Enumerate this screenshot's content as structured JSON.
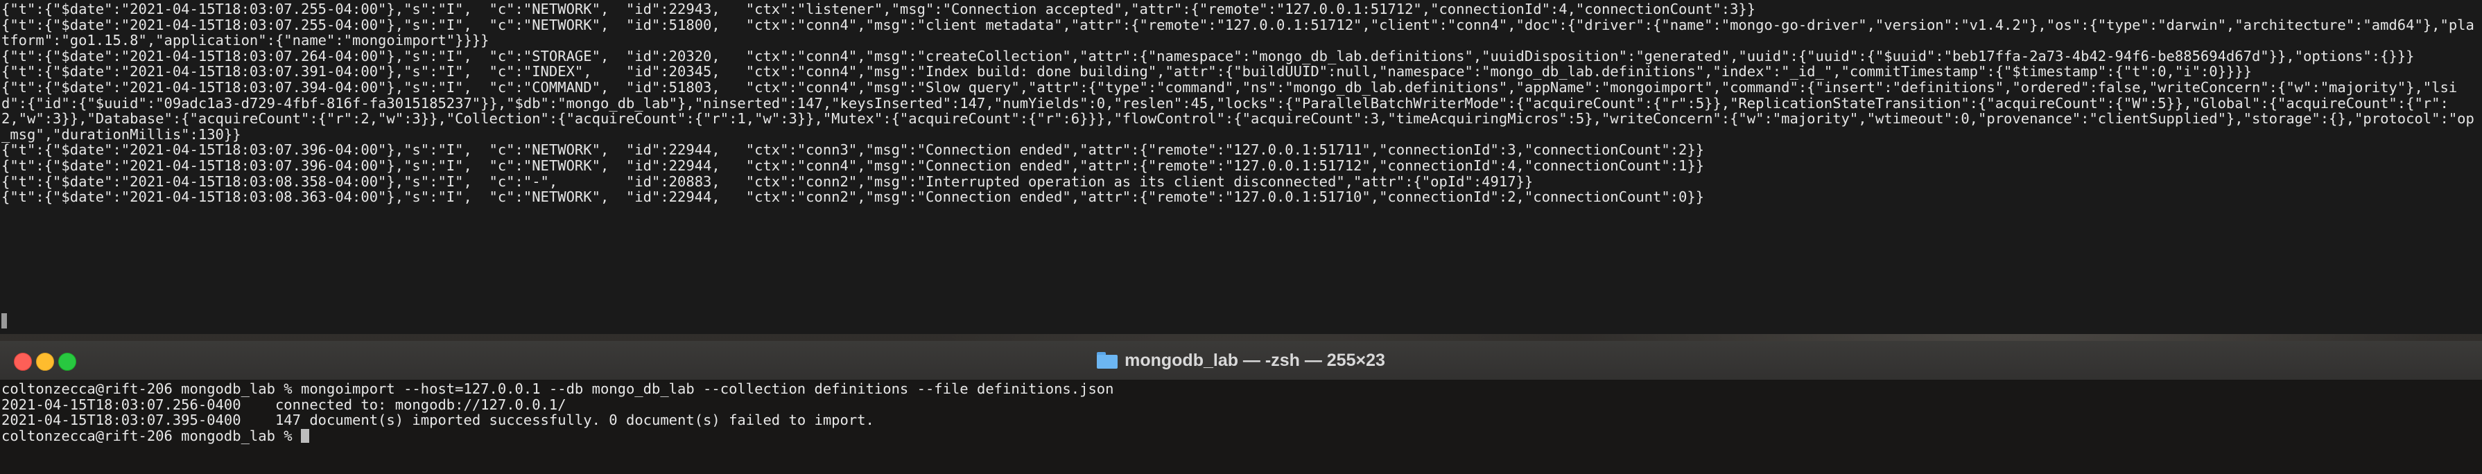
{
  "top_terminal": {
    "lines": [
      "{\"t\":{\"$date\":\"2021-04-15T18:03:07.255-04:00\"},\"s\":\"I\",  \"c\":\"NETWORK\",  \"id\":22943,   \"ctx\":\"listener\",\"msg\":\"Connection accepted\",\"attr\":{\"remote\":\"127.0.0.1:51712\",\"connectionId\":4,\"connectionCount\":3}}",
      "{\"t\":{\"$date\":\"2021-04-15T18:03:07.255-04:00\"},\"s\":\"I\",  \"c\":\"NETWORK\",  \"id\":51800,   \"ctx\":\"conn4\",\"msg\":\"client metadata\",\"attr\":{\"remote\":\"127.0.0.1:51712\",\"client\":\"conn4\",\"doc\":{\"driver\":{\"name\":\"mongo-go-driver\",\"version\":\"v1.4.2\"},\"os\":{\"type\":\"darwin\",\"architecture\":\"amd64\"},\"platform\":\"go1.15.8\",\"application\":{\"name\":\"mongoimport\"}}}}",
      "{\"t\":{\"$date\":\"2021-04-15T18:03:07.264-04:00\"},\"s\":\"I\",  \"c\":\"STORAGE\",  \"id\":20320,   \"ctx\":\"conn4\",\"msg\":\"createCollection\",\"attr\":{\"namespace\":\"mongo_db_lab.definitions\",\"uuidDisposition\":\"generated\",\"uuid\":{\"uuid\":{\"$uuid\":\"beb17ffa-2a73-4b42-94f6-be885694d67d\"}},\"options\":{}}}",
      "{\"t\":{\"$date\":\"2021-04-15T18:03:07.391-04:00\"},\"s\":\"I\",  \"c\":\"INDEX\",    \"id\":20345,   \"ctx\":\"conn4\",\"msg\":\"Index build: done building\",\"attr\":{\"buildUUID\":null,\"namespace\":\"mongo_db_lab.definitions\",\"index\":\"_id_\",\"commitTimestamp\":{\"$timestamp\":{\"t\":0,\"i\":0}}}}",
      "{\"t\":{\"$date\":\"2021-04-15T18:03:07.394-04:00\"},\"s\":\"I\",  \"c\":\"COMMAND\",  \"id\":51803,   \"ctx\":\"conn4\",\"msg\":\"Slow query\",\"attr\":{\"type\":\"command\",\"ns\":\"mongo_db_lab.definitions\",\"appName\":\"mongoimport\",\"command\":{\"insert\":\"definitions\",\"ordered\":false,\"writeConcern\":{\"w\":\"majority\"},\"lsid\":{\"id\":{\"$uuid\":\"09adc1a3-d729-4fbf-816f-fa3015185237\"}},\"$db\":\"mongo_db_lab\"},\"ninserted\":147,\"keysInserted\":147,\"numYields\":0,\"reslen\":45,\"locks\":{\"ParallelBatchWriterMode\":{\"acquireCount\":{\"r\":5}},\"ReplicationStateTransition\":{\"acquireCount\":{\"W\":5}},\"Global\":{\"acquireCount\":{\"r\":2,\"w\":3}},\"Database\":{\"acquireCount\":{\"r\":2,\"w\":3}},\"Collection\":{\"acquireCount\":{\"r\":1,\"w\":3}},\"Mutex\":{\"acquireCount\":{\"r\":6}}},\"flowControl\":{\"acquireCount\":3,\"timeAcquiringMicros\":5},\"writeConcern\":{\"w\":\"majority\",\"wtimeout\":0,\"provenance\":\"clientSupplied\"},\"storage\":{},\"protocol\":\"op_msg\",\"durationMillis\":130}}",
      "{\"t\":{\"$date\":\"2021-04-15T18:03:07.396-04:00\"},\"s\":\"I\",  \"c\":\"NETWORK\",  \"id\":22944,   \"ctx\":\"conn3\",\"msg\":\"Connection ended\",\"attr\":{\"remote\":\"127.0.0.1:51711\",\"connectionId\":3,\"connectionCount\":2}}",
      "{\"t\":{\"$date\":\"2021-04-15T18:03:07.396-04:00\"},\"s\":\"I\",  \"c\":\"NETWORK\",  \"id\":22944,   \"ctx\":\"conn4\",\"msg\":\"Connection ended\",\"attr\":{\"remote\":\"127.0.0.1:51712\",\"connectionId\":4,\"connectionCount\":1}}",
      "{\"t\":{\"$date\":\"2021-04-15T18:03:08.358-04:00\"},\"s\":\"I\",  \"c\":\"-\",        \"id\":20883,   \"ctx\":\"conn2\",\"msg\":\"Interrupted operation as its client disconnected\",\"attr\":{\"opId\":4917}}",
      "{\"t\":{\"$date\":\"2021-04-15T18:03:08.363-04:00\"},\"s\":\"I\",  \"c\":\"NETWORK\",  \"id\":22944,   \"ctx\":\"conn2\",\"msg\":\"Connection ended\",\"attr\":{\"remote\":\"127.0.0.1:51710\",\"connectionId\":2,\"connectionCount\":0}}"
    ]
  },
  "window": {
    "title": "mongodb_lab — -zsh — 255×23",
    "folder_icon": "folder-icon"
  },
  "terminal": {
    "lines": [
      "coltonzecca@rift-206 mongodb_lab % mongoimport --host=127.0.0.1 --db mongo_db_lab --collection definitions --file definitions.json",
      "2021-04-15T18:03:07.256-0400\tconnected to: mongodb://127.0.0.1/",
      "2021-04-15T18:03:07.395-0400\t147 document(s) imported successfully. 0 document(s) failed to import."
    ],
    "prompt": "coltonzecca@rift-206 mongodb_lab % "
  },
  "colors": {
    "close": "#fe5f57",
    "minimize": "#febc2e",
    "zoom": "#28c840"
  }
}
